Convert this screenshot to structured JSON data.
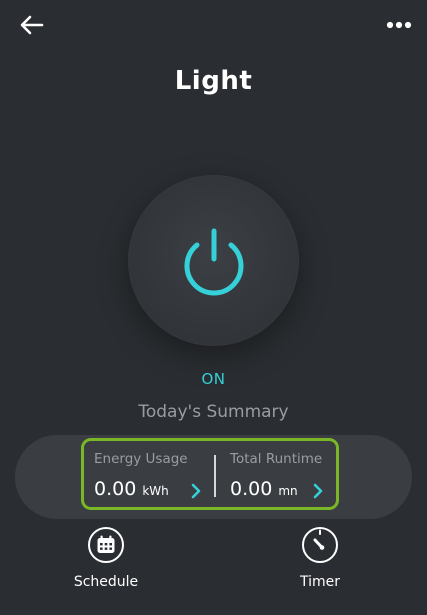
{
  "header": {
    "title": "Light"
  },
  "device": {
    "state": "ON"
  },
  "summary": {
    "title": "Today's Summary",
    "energy": {
      "label": "Energy Usage",
      "value": "0.00",
      "unit": "kWh"
    },
    "runtime": {
      "label": "Total Runtime",
      "value": "0.00",
      "unit": "mn"
    }
  },
  "actions": {
    "schedule_label": "Schedule",
    "timer_label": "Timer"
  },
  "icons": {
    "back": "back-arrow-icon",
    "more": "more-dots-icon",
    "power": "power-icon",
    "chevron": "chevron-right-icon",
    "calendar": "calendar-icon",
    "timer": "timer-icon"
  },
  "colors": {
    "background": "#2a2d31",
    "accent": "#35d0d8",
    "highlight": "#7ab727",
    "muted_text": "#9a9ca0"
  }
}
